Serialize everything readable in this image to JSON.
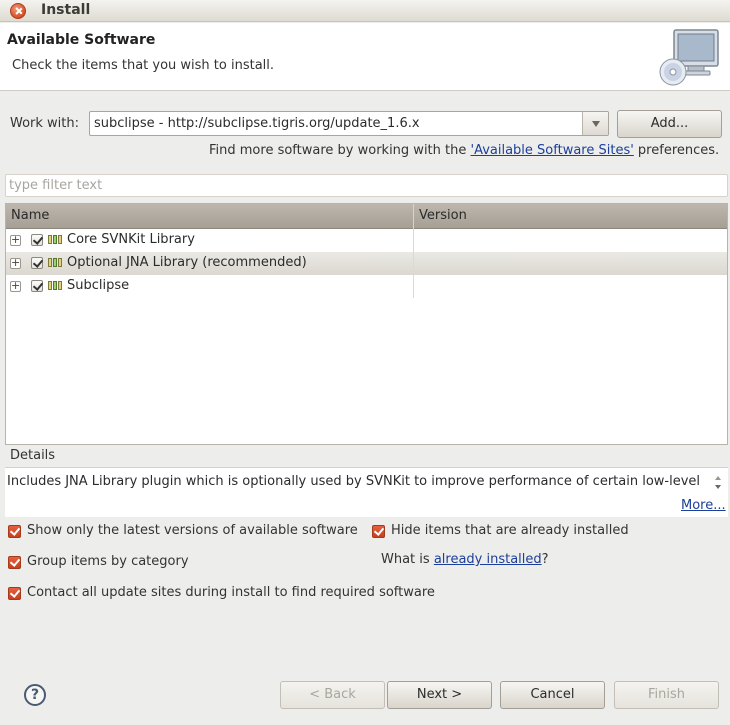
{
  "window": {
    "title": "Install"
  },
  "header": {
    "title": "Available Software",
    "description": "Check the items that you wish to install."
  },
  "work_with": {
    "label": "Work with:",
    "value": "subclipse - http://subclipse.tigris.org/update_1.6.x",
    "add_button": "Add..."
  },
  "find_more": {
    "prefix": "Find more software by working with the ",
    "link": "'Available Software Sites'",
    "suffix": " preferences."
  },
  "filter": {
    "placeholder": "type filter text"
  },
  "table": {
    "columns": [
      "Name",
      "Version"
    ],
    "rows": [
      {
        "name": "Core SVNKit Library",
        "version": "",
        "checked": true
      },
      {
        "name": "Optional JNA Library (recommended)",
        "version": "",
        "checked": true,
        "selected": true
      },
      {
        "name": "Subclipse",
        "version": "",
        "checked": true
      }
    ]
  },
  "details": {
    "label": "Details",
    "text": "Includes JNA Library plugin which is optionally used by SVNKit to improve performance of certain low-level",
    "more_link": "More..."
  },
  "options": {
    "show_latest": "Show only the latest versions of available software",
    "hide_installed": "Hide items that are already installed",
    "group_by_category": "Group items by category",
    "what_is_prefix": "What is ",
    "already_installed_link": "already installed",
    "what_is_suffix": "?",
    "contact_sites": "Contact all update sites during install to find required software"
  },
  "buttons": {
    "back": "< Back",
    "next": "Next >",
    "cancel": "Cancel",
    "finish": "Finish"
  },
  "colors": {
    "checkbox_accent": "#d9542c",
    "link": "#1b3f9a",
    "table_header": "#b3ada2"
  }
}
